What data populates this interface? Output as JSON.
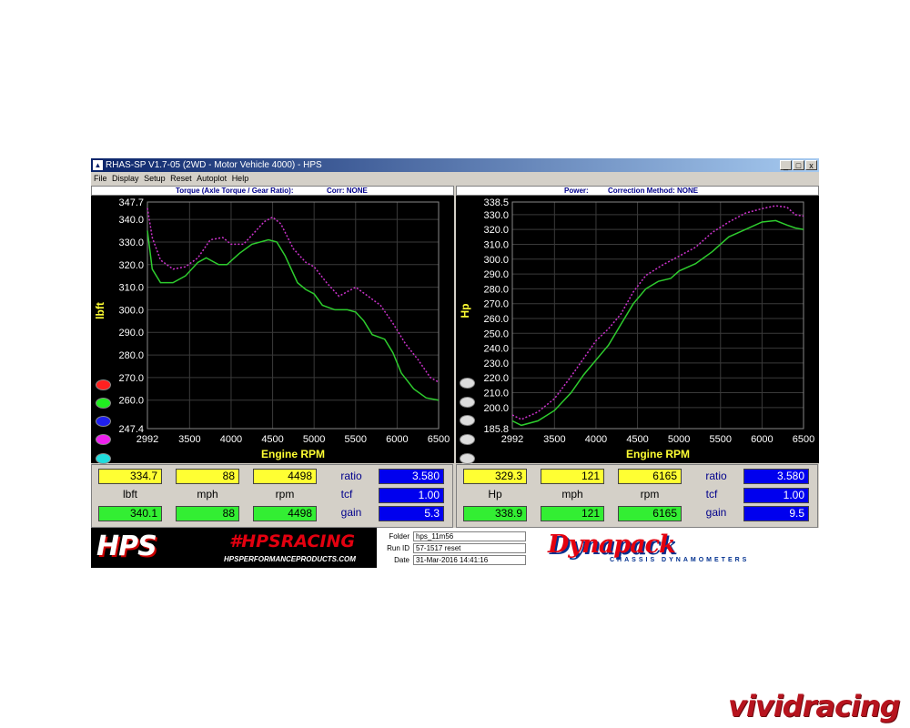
{
  "window": {
    "title": "RHAS-SP V1.7-05   (2WD - Motor Vehicle 4000) - HPS",
    "controls": [
      "_",
      "□",
      "x"
    ]
  },
  "menu": [
    "File",
    "Display",
    "Setup",
    "Reset",
    "Autoplot",
    "Help"
  ],
  "left_header": {
    "title": "Torque (Axle Torque / Gear Ratio):",
    "corr": "Corr: NONE"
  },
  "right_header": {
    "title": "Power:",
    "corr": "Correction Method: NONE"
  },
  "colors": {
    "green_trace": "#2ecc2e",
    "magenta_trace": "#cc33cc",
    "grid": "#3a3a3a"
  },
  "legend_bulbs": [
    "#ff2020",
    "#20ee20",
    "#2020ee",
    "#ee20ee",
    "#20dddd",
    "#ffff20"
  ],
  "chart_data": [
    {
      "type": "line",
      "title": "",
      "xlabel": "Engine RPM",
      "ylabel": "lbft",
      "xlim": [
        2992,
        6500
      ],
      "ylim": [
        247.4,
        347.7
      ],
      "x_ticks": [
        "2992",
        "3500",
        "4000",
        "4500",
        "5000",
        "5500",
        "6000",
        "6500"
      ],
      "x_tick_values": [
        2992,
        3500,
        4000,
        4500,
        5000,
        5500,
        6000,
        6500
      ],
      "y_ticks": [
        "247.4",
        "260.0",
        "270.0",
        "280.0",
        "290.0",
        "300.0",
        "310.0",
        "320.0",
        "330.0",
        "340.0",
        "347.7"
      ],
      "y_tick_values": [
        247.4,
        260,
        270,
        280,
        290,
        300,
        310,
        320,
        330,
        340,
        347.7
      ],
      "series": [
        {
          "color": "#2ecc2e",
          "points": [
            [
              2992,
              335
            ],
            [
              3050,
              318
            ],
            [
              3150,
              312
            ],
            [
              3300,
              312
            ],
            [
              3450,
              315
            ],
            [
              3600,
              321
            ],
            [
              3700,
              323
            ],
            [
              3850,
              320
            ],
            [
              3950,
              320
            ],
            [
              4100,
              325
            ],
            [
              4250,
              329
            ],
            [
              4450,
              331
            ],
            [
              4550,
              330
            ],
            [
              4650,
              324
            ],
            [
              4800,
              312
            ],
            [
              4900,
              309
            ],
            [
              5000,
              307
            ],
            [
              5100,
              302
            ],
            [
              5250,
              300
            ],
            [
              5400,
              300
            ],
            [
              5500,
              299
            ],
            [
              5600,
              295
            ],
            [
              5700,
              289
            ],
            [
              5850,
              287
            ],
            [
              5950,
              281
            ],
            [
              6050,
              272
            ],
            [
              6200,
              265
            ],
            [
              6350,
              261
            ],
            [
              6500,
              260
            ]
          ]
        },
        {
          "color": "#cc33cc",
          "points": [
            [
              2992,
              345
            ],
            [
              3050,
              332
            ],
            [
              3150,
              322
            ],
            [
              3300,
              318
            ],
            [
              3450,
              319
            ],
            [
              3600,
              323
            ],
            [
              3750,
              331
            ],
            [
              3900,
              332
            ],
            [
              4000,
              329
            ],
            [
              4150,
              329
            ],
            [
              4250,
              333
            ],
            [
              4400,
              339
            ],
            [
              4500,
              341
            ],
            [
              4600,
              338
            ],
            [
              4750,
              327
            ],
            [
              4900,
              321
            ],
            [
              5000,
              319
            ],
            [
              5150,
              312
            ],
            [
              5300,
              306
            ],
            [
              5500,
              310
            ],
            [
              5650,
              306
            ],
            [
              5800,
              302
            ],
            [
              5950,
              294
            ],
            [
              6100,
              285
            ],
            [
              6250,
              278
            ],
            [
              6400,
              270
            ],
            [
              6500,
              268
            ]
          ]
        }
      ]
    },
    {
      "type": "line",
      "title": "",
      "xlabel": "Engine RPM",
      "ylabel": "Hp",
      "xlim": [
        2992,
        6500
      ],
      "ylim": [
        185.8,
        338.5
      ],
      "x_ticks": [
        "2992",
        "3500",
        "4000",
        "4500",
        "5000",
        "5500",
        "6000",
        "6500"
      ],
      "x_tick_values": [
        2992,
        3500,
        4000,
        4500,
        5000,
        5500,
        6000,
        6500
      ],
      "y_ticks": [
        "185.8",
        "200.0",
        "210.0",
        "220.0",
        "230.0",
        "240.0",
        "250.0",
        "260.0",
        "270.0",
        "280.0",
        "290.0",
        "300.0",
        "310.0",
        "320.0",
        "330.0",
        "338.5"
      ],
      "y_tick_values": [
        185.8,
        200,
        210,
        220,
        230,
        240,
        250,
        260,
        270,
        280,
        290,
        300,
        310,
        320,
        330,
        338.5
      ],
      "series": [
        {
          "color": "#2ecc2e",
          "points": [
            [
              2992,
              191
            ],
            [
              3100,
              188
            ],
            [
              3300,
              191
            ],
            [
              3500,
              198
            ],
            [
              3700,
              210
            ],
            [
              3850,
              222
            ],
            [
              4000,
              232
            ],
            [
              4150,
              242
            ],
            [
              4300,
              256
            ],
            [
              4450,
              270
            ],
            [
              4600,
              280
            ],
            [
              4750,
              285
            ],
            [
              4900,
              287
            ],
            [
              5000,
              292
            ],
            [
              5200,
              297
            ],
            [
              5400,
              305
            ],
            [
              5600,
              315
            ],
            [
              5800,
              320
            ],
            [
              6000,
              325
            ],
            [
              6165,
              326
            ],
            [
              6300,
              323
            ],
            [
              6400,
              321
            ],
            [
              6500,
              320
            ]
          ]
        },
        {
          "color": "#cc33cc",
          "points": [
            [
              2992,
              195
            ],
            [
              3100,
              192
            ],
            [
              3300,
              197
            ],
            [
              3500,
              206
            ],
            [
              3700,
              221
            ],
            [
              3850,
              233
            ],
            [
              4000,
              245
            ],
            [
              4150,
              253
            ],
            [
              4300,
              263
            ],
            [
              4450,
              278
            ],
            [
              4600,
              289
            ],
            [
              4800,
              296
            ],
            [
              5000,
              302
            ],
            [
              5200,
              308
            ],
            [
              5400,
              318
            ],
            [
              5600,
              325
            ],
            [
              5800,
              331
            ],
            [
              6000,
              334
            ],
            [
              6165,
              336
            ],
            [
              6300,
              335
            ],
            [
              6400,
              330
            ],
            [
              6500,
              329
            ]
          ]
        }
      ]
    }
  ],
  "readouts_left": {
    "row1": [
      "334.7",
      "88",
      "4498"
    ],
    "labels": [
      "lbft",
      "mph",
      "rpm"
    ],
    "row2": [
      "340.1",
      "88",
      "4498"
    ],
    "side_labels": [
      "ratio",
      "tcf",
      "gain"
    ],
    "side_values": [
      "3.580",
      "1.00",
      "5.3"
    ]
  },
  "readouts_right": {
    "row1": [
      "329.3",
      "121",
      "6165"
    ],
    "labels": [
      "Hp",
      "mph",
      "rpm"
    ],
    "row2": [
      "338.9",
      "121",
      "6165"
    ],
    "side_labels": [
      "ratio",
      "tcf",
      "gain"
    ],
    "side_values": [
      "3.580",
      "1.00",
      "9.5"
    ]
  },
  "footer": {
    "hps_logo": "HPS",
    "hashtag": "#HPSRACING",
    "url": "HPSPERFORMANCEPRODUCTS.COM",
    "folder_label": "Folder",
    "folder_value": "hps_11m56",
    "run_label": "Run ID",
    "run_value": "57-1517 reset",
    "date_label": "Date",
    "date_value": "31-Mar-2016   14:41:16",
    "dyna_logo": "Dynapack",
    "dyna_sub": "CHASSIS  DYNAMOMETERS"
  },
  "watermark": "vividracing"
}
